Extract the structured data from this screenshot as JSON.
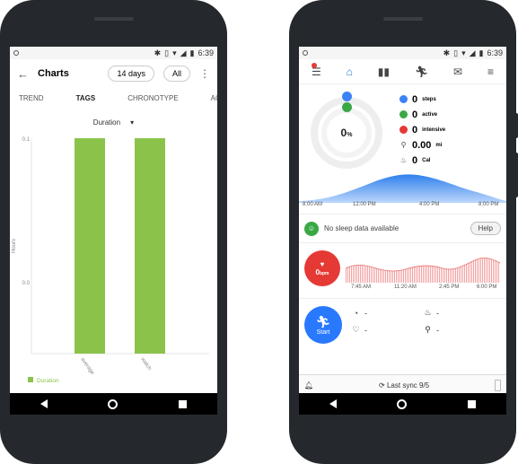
{
  "left": {
    "status": {
      "time": "6:39"
    },
    "header": {
      "back": "←",
      "title": "Charts",
      "range_pill": "14 days",
      "all_pill": "All",
      "menu": "⋮"
    },
    "tabs": [
      {
        "label": "TREND"
      },
      {
        "label": "TAGS",
        "active": true
      },
      {
        "label": "CHRONOTYPE"
      },
      {
        "label": "AC"
      }
    ],
    "dropdown": {
      "value": "Duration",
      "caret": "▾"
    },
    "chart_data": {
      "type": "bar",
      "categories": [
        "average",
        "watch"
      ],
      "series": [
        {
          "name": "Duration",
          "values": [
            0.1,
            0.1
          ],
          "color": "#8bc34a"
        }
      ],
      "ylabel": "Hours",
      "y_ticks": [
        "0.1",
        "0.0"
      ],
      "ylim": [
        -0.05,
        0.1
      ],
      "legend": "bottom-left",
      "grid": false
    }
  },
  "right": {
    "status": {
      "time": "6:39"
    },
    "toolbar": {
      "icons": [
        "menu-icon",
        "home-icon",
        "bar-chart-icon",
        "running-icon",
        "message-icon",
        "sliders-icon"
      ]
    },
    "summary": {
      "percent": "0",
      "percent_unit": "%",
      "steps": {
        "value": "0",
        "unit": "steps",
        "color": "#3b82f6"
      },
      "active": {
        "value": "0",
        "unit": "active",
        "color": "#3aa845"
      },
      "intensive": {
        "value": "0",
        "unit": "intensive",
        "color": "#e53935"
      },
      "distance": {
        "value": "0.00",
        "unit": "mi"
      },
      "calories": {
        "value": "0",
        "unit": "Cal"
      },
      "times": [
        "8:00 AM",
        "12:00 PM",
        "4:00 PM",
        "8:00 PM"
      ]
    },
    "sleep": {
      "text": "No sleep data available",
      "help": "Help"
    },
    "heart": {
      "value": "0",
      "unit": "bpm",
      "times": [
        "7:45 AM",
        "11:20 AM",
        "2:45 PM",
        "6:00 PM"
      ]
    },
    "activity": {
      "start": "Start",
      "values": [
        "-",
        "-",
        "-",
        "-"
      ]
    },
    "sync": {
      "text": "Last sync 9/5"
    }
  }
}
